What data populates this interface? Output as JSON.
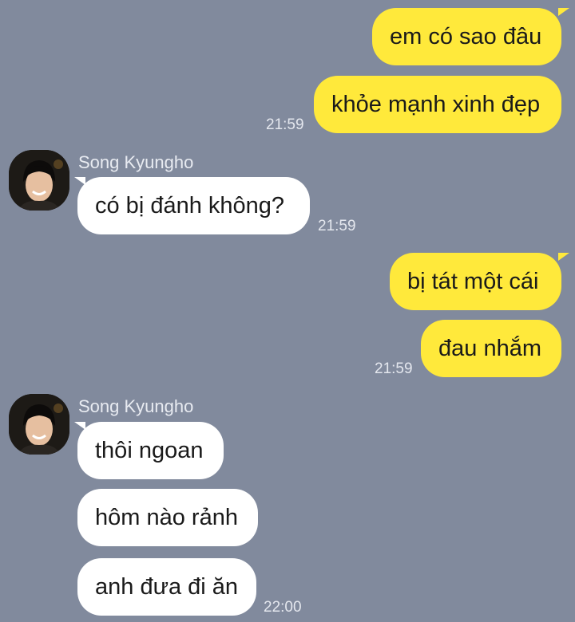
{
  "messages": [
    {
      "side": "out",
      "text": "em có sao đâu"
    },
    {
      "side": "out",
      "text": "khỏe mạnh xinh đẹp",
      "time": "21:59"
    },
    {
      "side": "in",
      "sender": "Song Kyungho",
      "text": "có bị đánh không?",
      "time": "21:59"
    },
    {
      "side": "out",
      "text": "bị tát một cái"
    },
    {
      "side": "out",
      "text": "đau nhắm",
      "time": "21:59"
    },
    {
      "side": "in",
      "sender": "Song Kyungho",
      "text": "thôi ngoan"
    },
    {
      "side": "in",
      "text": "hôm nào rảnh"
    },
    {
      "side": "in",
      "text": "anh đưa đi ăn",
      "time": "22:00"
    }
  ],
  "colors": {
    "background": "#818a9d",
    "outgoing_bubble": "#ffe93b",
    "incoming_bubble": "#ffffff"
  }
}
